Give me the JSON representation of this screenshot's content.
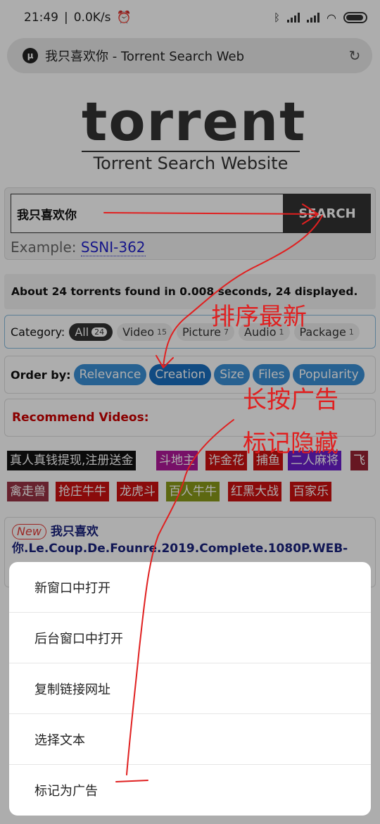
{
  "status": {
    "time": "21:49",
    "speed": "0.0K/s"
  },
  "addressbar": {
    "site_icon": "μ",
    "title": "我只喜欢你 - Torrent Search Web"
  },
  "logo": {
    "main": "torrent",
    "sub": "Torrent Search Website"
  },
  "search": {
    "query": "我只喜欢你",
    "button": "SEARCH",
    "example_label": "Example:",
    "example_link": "SSNI-362"
  },
  "results_summary": "About 24 torrents found in 0.008 seconds, 24 displayed.",
  "category": {
    "label": "Category:",
    "items": [
      {
        "label": "All",
        "count": "24"
      },
      {
        "label": "Video",
        "count": "15"
      },
      {
        "label": "Picture",
        "count": "7"
      },
      {
        "label": "Audio",
        "count": "1"
      },
      {
        "label": "Package",
        "count": "1"
      }
    ]
  },
  "order": {
    "label": "Order by:",
    "items": [
      "Relevance",
      "Creation",
      "Size",
      "Files",
      "Popularity"
    ]
  },
  "recommend": "Recommend Videos:",
  "ads": [
    {
      "text": "真人真钱提现,注册送金",
      "color": "#111111"
    },
    {
      "text": "斗地主",
      "color": "#b0189a"
    },
    {
      "text": "诈金花",
      "color": "#cc1111"
    },
    {
      "text": "捕鱼",
      "color": "#cc1111"
    },
    {
      "text": "二人麻将",
      "color": "#6a1ecc"
    },
    {
      "text": "飞",
      "color": "#992233"
    },
    {
      "text": "禽走兽",
      "color": "#993344"
    },
    {
      "text": "抢庄牛牛",
      "color": "#cc1111"
    },
    {
      "text": "龙虎斗",
      "color": "#cc1111"
    },
    {
      "text": "百人牛牛",
      "color": "#8a9a1a"
    },
    {
      "text": "红黑大战",
      "color": "#cc1111"
    },
    {
      "text": "百家乐",
      "color": "#cc1111"
    }
  ],
  "result": {
    "tag": "New",
    "title": "我只喜欢你.Le.Coup.De.Founre.2019.Complete.1080P.WEB-"
  },
  "context_menu": [
    "新窗口中打开",
    "后台窗口中打开",
    "复制链接网址",
    "选择文本",
    "标记为广告"
  ],
  "annotations": {
    "sort_newest": "排序最新",
    "long_press_ad": "长按广告",
    "mark_hide": "标记隐藏"
  },
  "colors": {
    "annotation": "#e02020",
    "order_button": "#3a8fd6",
    "dim_overlay": "rgba(0,0,0,0.32)"
  }
}
